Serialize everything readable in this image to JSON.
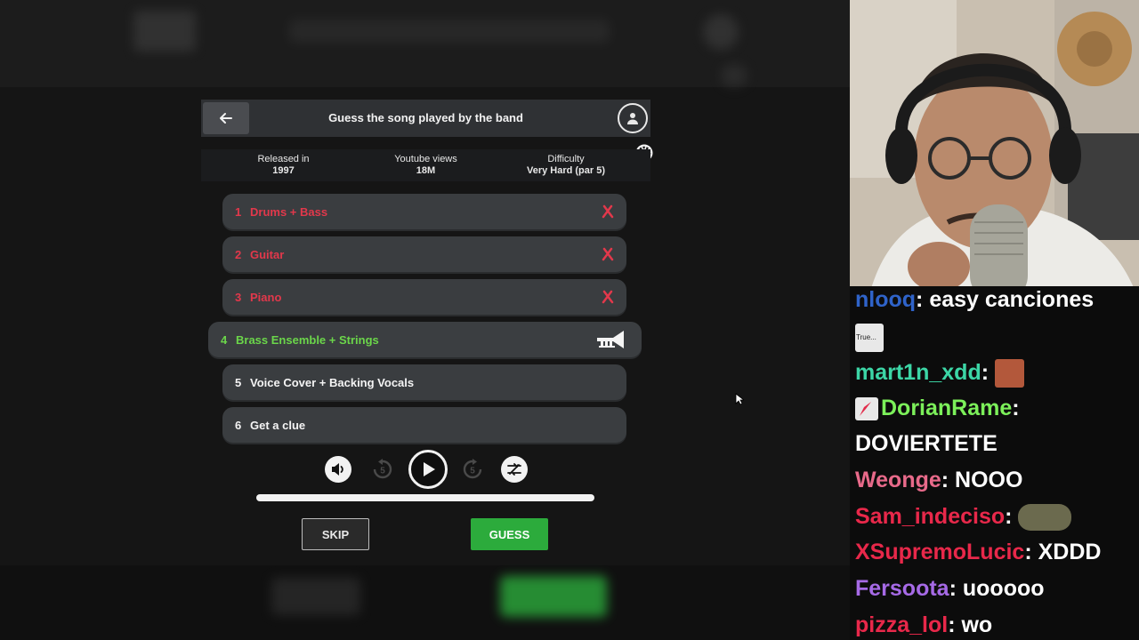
{
  "header": {
    "title": "Guess the song played by the band"
  },
  "stats": {
    "released_label": "Released in",
    "released_value": "1997",
    "views_label": "Youtube views",
    "views_value": "18M",
    "difficulty_label": "Difficulty",
    "difficulty_value": "Very Hard (par 5)"
  },
  "clues": [
    {
      "num": "1",
      "label": "Drums + Bass",
      "state": "failed"
    },
    {
      "num": "2",
      "label": "Guitar",
      "state": "failed"
    },
    {
      "num": "3",
      "label": "Piano",
      "state": "failed"
    },
    {
      "num": "4",
      "label": "Brass Ensemble + Strings",
      "state": "current"
    },
    {
      "num": "5",
      "label": "Voice Cover + Backing Vocals",
      "state": "locked"
    },
    {
      "num": "6",
      "label": "Get a clue",
      "state": "locked"
    }
  ],
  "controls": {
    "rewind_seconds": "5",
    "forward_seconds": "5",
    "progress": 1.0
  },
  "buttons": {
    "skip": "SKIP",
    "guess": "GUESS"
  },
  "chat": {
    "messages": [
      {
        "user": "nlooq",
        "text": "easy canciones",
        "color": "#2f63c9"
      },
      {
        "user": "",
        "text": "",
        "color": "#ffffff",
        "emote_only": true,
        "emote_label": "True..."
      },
      {
        "user": "mart1n_xdd",
        "text": "",
        "color": "#3cd6a6"
      },
      {
        "user": "DorianRame",
        "text": "",
        "color": "#7cf05a"
      },
      {
        "user": "",
        "text": "DOVIERTETE",
        "color": "#ffffff"
      },
      {
        "user": "Weonge",
        "text": "NOOO",
        "color": "#e86a8a"
      },
      {
        "user": "Sam_indeciso",
        "text": "",
        "color": "#e8284a"
      },
      {
        "user": "XSupremoLucic",
        "text": "XDDD",
        "color": "#e8284a"
      },
      {
        "user": "Fersoota",
        "text": "uooooo",
        "color": "#a66ae6"
      },
      {
        "user": "pizza_lol",
        "text": "wo",
        "color": "#e8284a"
      }
    ]
  },
  "colors": {
    "failed": "#e2384b",
    "current": "#6bd64a",
    "guess": "#2cab3c"
  }
}
